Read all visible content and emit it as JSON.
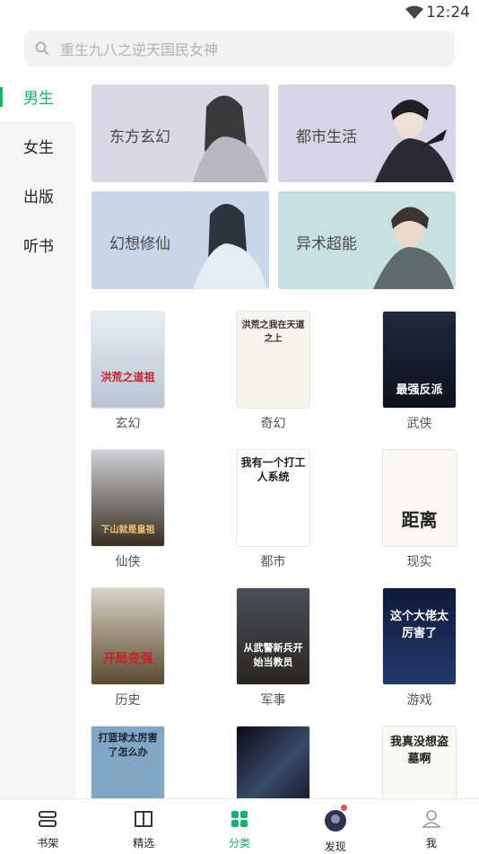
{
  "status": {
    "time": "12:24"
  },
  "search": {
    "placeholder": "重生九八之逆天国民女神"
  },
  "sidebar": {
    "items": [
      {
        "label": "男生"
      },
      {
        "label": "女生"
      },
      {
        "label": "出版"
      },
      {
        "label": "听书"
      }
    ]
  },
  "banners": [
    {
      "label": "东方玄幻",
      "color": "#d9d5e4"
    },
    {
      "label": "都市生活",
      "color": "#d8d4e6"
    },
    {
      "label": "幻想修仙",
      "color": "#c6d6e8"
    },
    {
      "label": "异术超能",
      "color": "#c8dfe0"
    }
  ],
  "books": [
    {
      "label": "玄幻",
      "cover_title": "洪荒之道祖"
    },
    {
      "label": "奇幻",
      "cover_title": "洪荒之我在天道之上"
    },
    {
      "label": "武侠",
      "cover_title": "最强反派"
    },
    {
      "label": "仙侠",
      "cover_title": "下山就是皇祖"
    },
    {
      "label": "都市",
      "cover_title": "我有一个打工人系统"
    },
    {
      "label": "现实",
      "cover_title": "距离"
    },
    {
      "label": "历史",
      "cover_title": "开局变强"
    },
    {
      "label": "军事",
      "cover_title": "从武警新兵开始当教员"
    },
    {
      "label": "游戏",
      "cover_title": "这个大佬太厉害了"
    },
    {
      "label": "",
      "cover_title": "打篮球太厉害了怎么办"
    },
    {
      "label": "",
      "cover_title": ""
    },
    {
      "label": "",
      "cover_title": "我真没想盗墓啊"
    }
  ],
  "tabbar": {
    "items": [
      {
        "label": "书架",
        "icon": "bookshelf-icon"
      },
      {
        "label": "精选",
        "icon": "book-open-icon"
      },
      {
        "label": "分类",
        "icon": "category-grid-icon"
      },
      {
        "label": "发现",
        "icon": "discover-avatar-icon"
      },
      {
        "label": "我",
        "icon": "user-icon"
      }
    ]
  },
  "colors": {
    "accent": "#18b26b",
    "badge": "#e84a57"
  }
}
